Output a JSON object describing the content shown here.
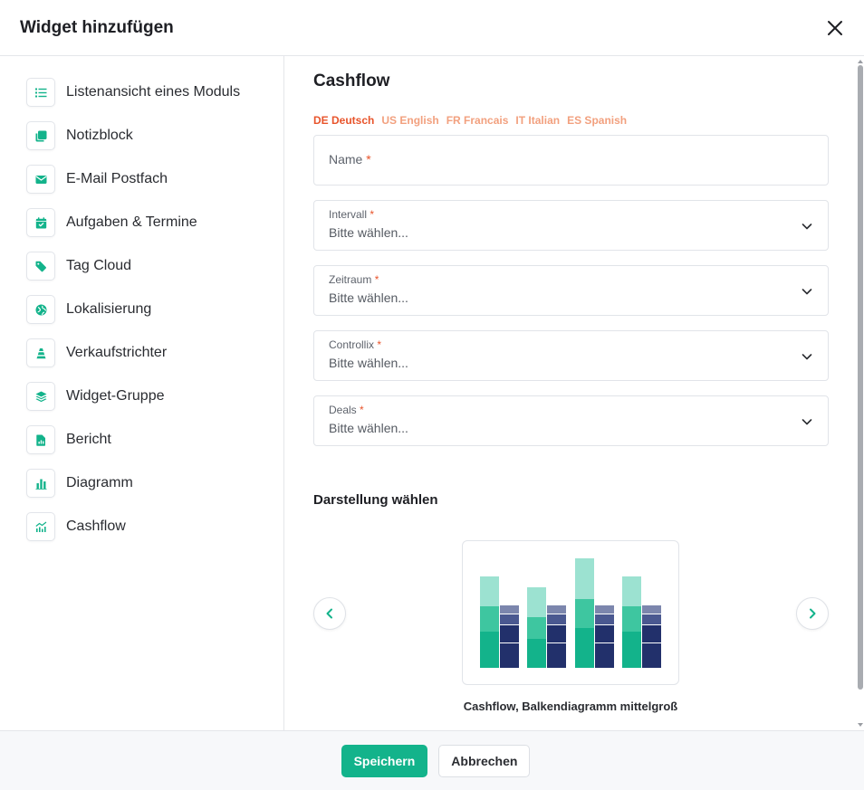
{
  "dialog": {
    "title": "Widget hinzufügen",
    "close_icon": "close-icon"
  },
  "sidebar": {
    "items": [
      {
        "label": "Listenansicht eines Moduls",
        "icon": "list-icon"
      },
      {
        "label": "Notizblock",
        "icon": "notes-icon"
      },
      {
        "label": "E-Mail Postfach",
        "icon": "mail-icon"
      },
      {
        "label": "Aufgaben & Termine",
        "icon": "calendar-icon"
      },
      {
        "label": "Tag Cloud",
        "icon": "tag-icon"
      },
      {
        "label": "Lokalisierung",
        "icon": "globe-icon"
      },
      {
        "label": "Verkaufstrichter",
        "icon": "funnel-icon"
      },
      {
        "label": "Widget-Gruppe",
        "icon": "layers-icon"
      },
      {
        "label": "Bericht",
        "icon": "report-icon"
      },
      {
        "label": "Diagramm",
        "icon": "bar-chart-icon"
      },
      {
        "label": "Cashflow",
        "icon": "cashflow-icon"
      }
    ]
  },
  "main": {
    "title": "Cashflow",
    "languages": [
      {
        "label": "DE Deutsch",
        "active": true
      },
      {
        "label": "US English",
        "active": false
      },
      {
        "label": "FR Francais",
        "active": false
      },
      {
        "label": "IT Italian",
        "active": false
      },
      {
        "label": "ES Spanish",
        "active": false
      }
    ],
    "name_field": {
      "label": "Name",
      "required_mark": "*"
    },
    "selects": [
      {
        "label": "Intervall",
        "required_mark": "*",
        "value": "Bitte wählen..."
      },
      {
        "label": "Zeitraum",
        "required_mark": "*",
        "value": "Bitte wählen..."
      },
      {
        "label": "Controllix",
        "required_mark": "*",
        "value": "Bitte wählen..."
      },
      {
        "label": "Deals",
        "required_mark": "*",
        "value": "Bitte wählen..."
      }
    ],
    "display_section_title": "Darstellung wählen",
    "preview_caption": "Cashflow, Balkendiagramm mittelgroß"
  },
  "footer": {
    "save_label": "Speichern",
    "cancel_label": "Abbrechen"
  },
  "colors": {
    "accent": "#13b38b",
    "lang_active": "#e8542b",
    "lang_inactive": "#f2a07e",
    "green_dark": "#13b38b",
    "green_mid": "#3ec6a0",
    "green_light": "#9ce2d1",
    "navy_dark": "#22306b",
    "navy_mid": "#4a5890",
    "navy_light": "#7c86ad"
  }
}
